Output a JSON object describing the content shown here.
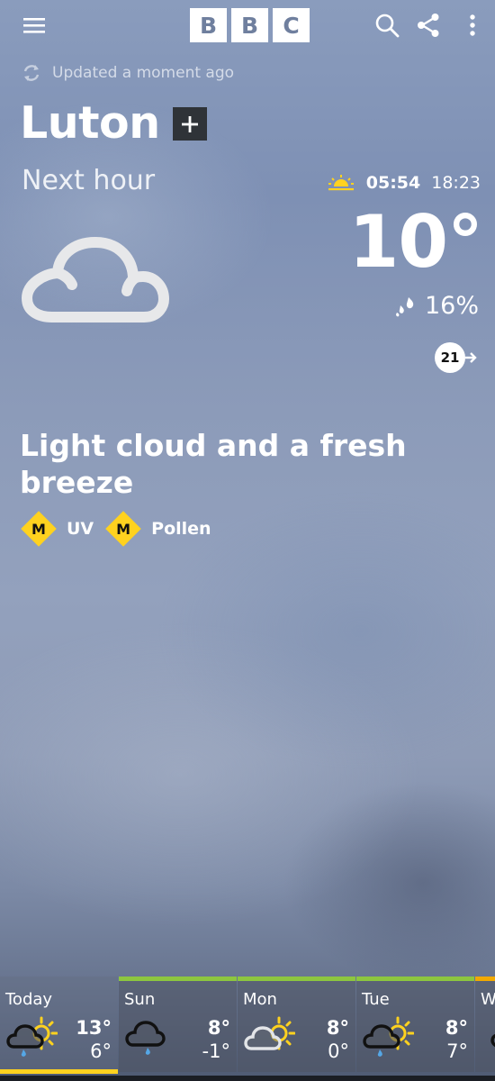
{
  "brand": {
    "letters": [
      "B",
      "B",
      "C"
    ]
  },
  "header": {
    "menu_icon": "hamburger-menu-icon",
    "search_icon": "search-icon",
    "share_icon": "share-icon",
    "more_icon": "more-vertical-icon"
  },
  "status": {
    "updated_text": "Updated a moment ago",
    "refresh_icon": "refresh-icon"
  },
  "location": {
    "name": "Luton",
    "add_icon": "plus-icon"
  },
  "now": {
    "period_label": "Next hour",
    "weather_icon": "light-cloud-icon",
    "sunrise": "05:54",
    "sunset": "18:23",
    "temperature": "10°",
    "precip_chance": "16%",
    "wind_speed": "21",
    "summary": "Light cloud and a fresh breeze"
  },
  "badges": [
    {
      "level": "M",
      "label": "UV"
    },
    {
      "level": "M",
      "label": "Pollen"
    }
  ],
  "forecast": [
    {
      "day": "Today",
      "high": "13°",
      "low": "6°",
      "icon": "sunny-intervals-light-rain-icon"
    },
    {
      "day": "Sun",
      "high": "8°",
      "low": "-1°",
      "icon": "light-rain-icon"
    },
    {
      "day": "Mon",
      "high": "8°",
      "low": "0°",
      "icon": "sunny-intervals-icon"
    },
    {
      "day": "Tue",
      "high": "8°",
      "low": "7°",
      "icon": "sunny-intervals-light-rain-icon"
    },
    {
      "day": "We",
      "high": "",
      "low": "",
      "icon": "cloud-icon"
    }
  ],
  "colors": {
    "accent_yellow": "#ffd21f",
    "forecast_bar_green": "#8dc63f",
    "forecast_bar_orange": "#f2a900"
  }
}
